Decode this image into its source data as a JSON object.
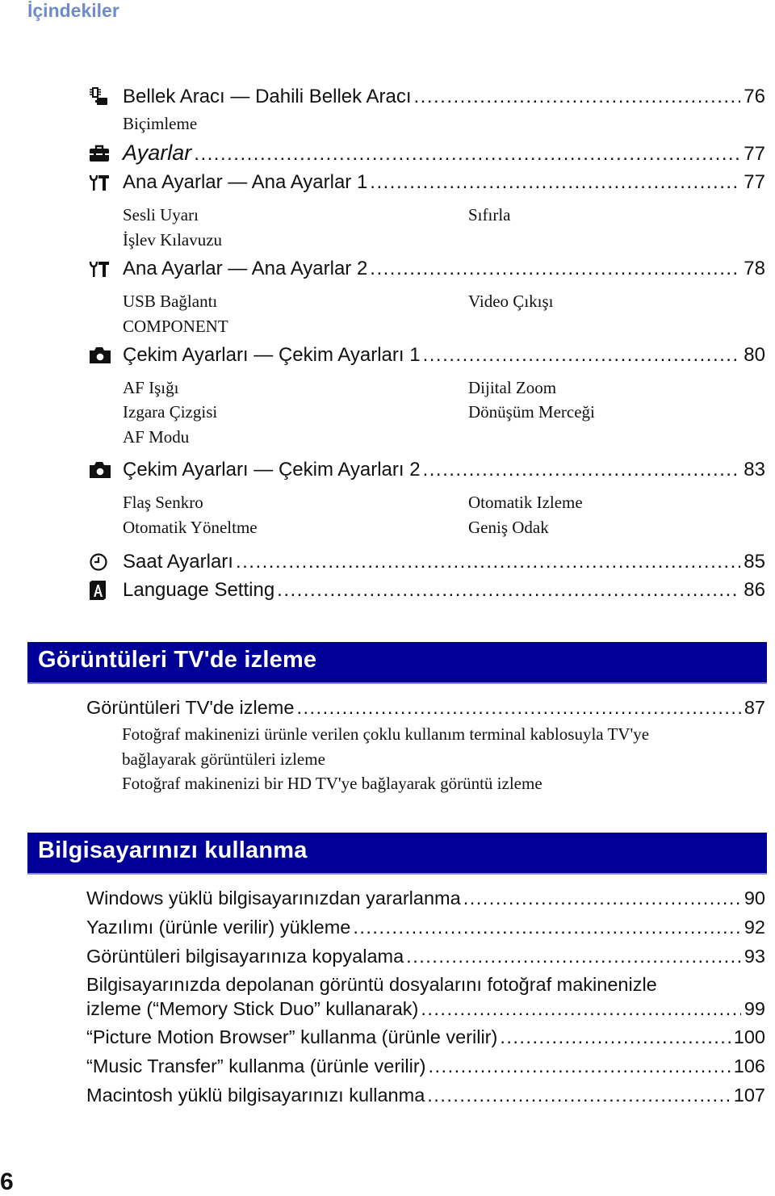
{
  "header": {
    "title": "İçindekiler"
  },
  "settings_section": {
    "entries": [
      {
        "icon": "memory-tool-icon",
        "label": "Bellek Aracı — Dahili Bellek Aracı",
        "page": "76",
        "subitems_left": [
          "Biçimleme"
        ],
        "subitems_right": []
      },
      {
        "icon": "toolbox-icon",
        "label": "Ayarlar",
        "page": "77",
        "italic": true,
        "subitems_left": [],
        "subitems_right": []
      },
      {
        "icon": "tools-icon",
        "label": "Ana Ayarlar — Ana Ayarlar 1",
        "page": "77",
        "subitems_left": [
          "Sesli Uyarı",
          "İşlev Kılavuzu"
        ],
        "subitems_right": [
          "Sıfırla"
        ]
      },
      {
        "icon": "tools-icon",
        "label": "Ana Ayarlar — Ana Ayarlar 2",
        "page": "78",
        "subitems_left": [
          "USB Bağlantı",
          "COMPONENT"
        ],
        "subitems_right": [
          "Video Çıkışı"
        ]
      },
      {
        "icon": "camera-icon",
        "label": "Çekim Ayarları — Çekim Ayarları 1",
        "page": "80",
        "subitems_left": [
          "AF Işığı",
          "Izgara Çizgisi",
          "AF Modu"
        ],
        "subitems_right": [
          "Dijital Zoom",
          "Dönüşüm Merceği"
        ]
      },
      {
        "icon": "camera-icon",
        "label": "Çekim Ayarları — Çekim Ayarları 2",
        "page": "83",
        "subitems_left": [
          "Flaş Senkro",
          "Otomatik Yöneltme"
        ],
        "subitems_right": [
          "Otomatik Izleme",
          "Geniş Odak"
        ]
      },
      {
        "icon": "clock-icon",
        "label": "Saat Ayarları",
        "page": "85",
        "subitems_left": [],
        "subitems_right": []
      },
      {
        "icon": "language-icon",
        "label": "Language Setting",
        "page": "86",
        "subitems_left": [],
        "subitems_right": []
      }
    ]
  },
  "tv_section": {
    "heading": "Görüntüleri TV'de izleme",
    "entries": [
      {
        "label": "Görüntüleri TV'de izleme",
        "page": "87"
      }
    ],
    "descriptions": [
      "Fotoğraf makinenizi ürünle verilen çoklu kullanım terminal kablosuyla TV'ye",
      "bağlayarak görüntüleri izleme",
      "Fotoğraf makinenizi bir HD TV'ye bağlayarak görüntü izleme"
    ]
  },
  "pc_section": {
    "heading": "Bilgisayarınızı kullanma",
    "entries": [
      {
        "label": "Windows yüklü bilgisayarınızdan yararlanma",
        "page": "90"
      },
      {
        "label": "Yazılımı (ürünle verilir) yükleme",
        "page": "92"
      },
      {
        "label": "Görüntüleri bilgisayarınıza kopyalama",
        "page": "93"
      },
      {
        "label_line1": "Bilgisayarınızda depolanan görüntü dosyalarını fotoğraf makinenizle",
        "label": "izleme (“Memory Stick Duo” kullanarak)",
        "page": "99"
      },
      {
        "label": "“Picture Motion Browser” kullanma (ürünle verilir)",
        "page": "100"
      },
      {
        "label": "“Music Transfer” kullanma (ürünle verilir)",
        "page": "106"
      },
      {
        "label": "Macintosh yüklü bilgisayarınızı kullanma",
        "page": "107"
      }
    ]
  },
  "footer": {
    "page_number": "6"
  },
  "colors": {
    "header_text": "#6f8bc9",
    "band_background": "#000099",
    "band_text": "#ffffff"
  }
}
